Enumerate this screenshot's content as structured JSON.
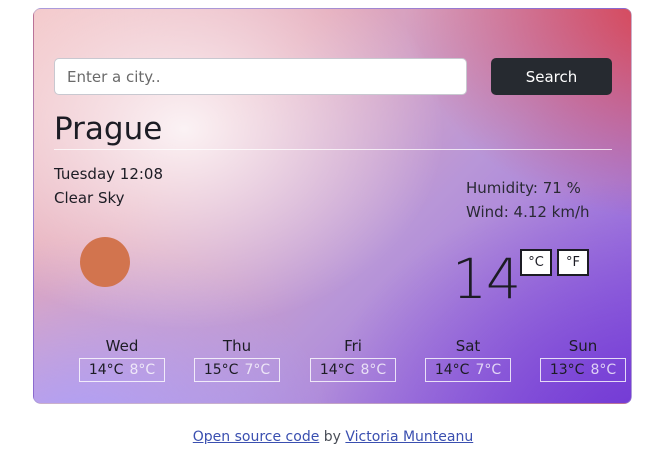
{
  "search": {
    "placeholder": "Enter a city..",
    "value": "",
    "button_label": "Search"
  },
  "weather": {
    "city": "Prague",
    "date": "Tuesday 12:08",
    "description": "Clear Sky",
    "humidity": "Humidity: 71 %",
    "wind": "Wind: 4.12 km/h",
    "temperature": "14",
    "icon": "sun-icon",
    "unit_celsius": "°C",
    "unit_fahrenheit": "°F"
  },
  "forecast": [
    {
      "day": "Wed",
      "max": "14°C",
      "min": "8°C"
    },
    {
      "day": "Thu",
      "max": "15°C",
      "min": "7°C"
    },
    {
      "day": "Fri",
      "max": "14°C",
      "min": "8°C"
    },
    {
      "day": "Sat",
      "max": "14°C",
      "min": "7°C"
    },
    {
      "day": "Sun",
      "max": "13°C",
      "min": "8°C"
    }
  ],
  "footer": {
    "source_link": "Open source code",
    "by_text": " by ",
    "author_link": "Victoria Munteanu"
  },
  "colors": {
    "sun": "#d2744e",
    "button_bg": "#262a30"
  }
}
